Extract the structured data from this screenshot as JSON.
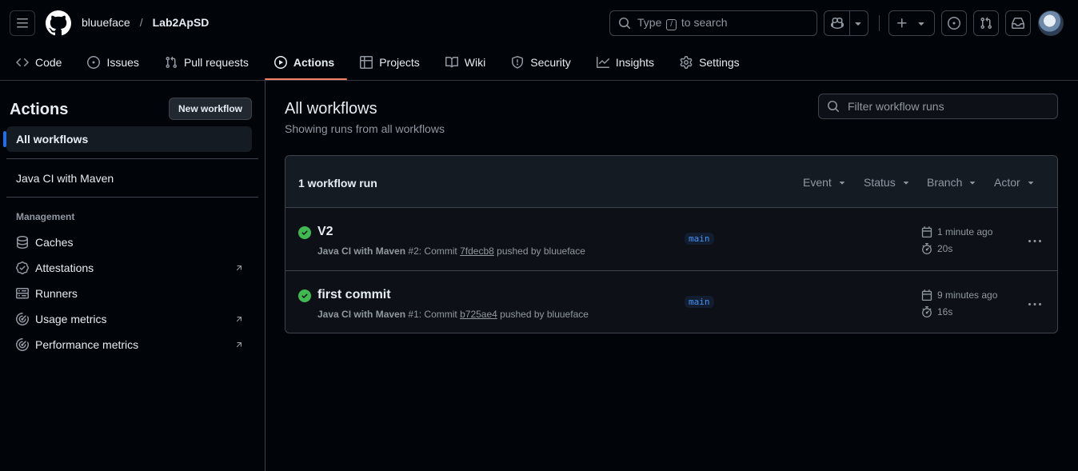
{
  "header": {
    "owner": "bluueface",
    "separator": "/",
    "repo": "Lab2ApSD",
    "search_prefix": "Type",
    "search_key": "/",
    "search_suffix": "to search"
  },
  "tabs": [
    {
      "label": "Code",
      "icon": "code-icon"
    },
    {
      "label": "Issues",
      "icon": "issue-icon"
    },
    {
      "label": "Pull requests",
      "icon": "pull-request-icon"
    },
    {
      "label": "Actions",
      "icon": "play-icon",
      "active": true
    },
    {
      "label": "Projects",
      "icon": "table-icon"
    },
    {
      "label": "Wiki",
      "icon": "book-icon"
    },
    {
      "label": "Security",
      "icon": "shield-icon"
    },
    {
      "label": "Insights",
      "icon": "graph-icon"
    },
    {
      "label": "Settings",
      "icon": "gear-icon"
    }
  ],
  "sidebar": {
    "title": "Actions",
    "new_workflow": "New workflow",
    "all_workflows": "All workflows",
    "workflow": "Java CI with Maven",
    "management_heading": "Management",
    "management": [
      {
        "label": "Caches",
        "icon": "database-icon"
      },
      {
        "label": "Attestations",
        "icon": "verified-icon",
        "external": true
      },
      {
        "label": "Runners",
        "icon": "server-icon"
      },
      {
        "label": "Usage metrics",
        "icon": "meter-icon",
        "external": true
      },
      {
        "label": "Performance metrics",
        "icon": "meter-icon",
        "external": true
      }
    ]
  },
  "main": {
    "title": "All workflows",
    "subtitle": "Showing runs from all workflows",
    "filter_placeholder": "Filter workflow runs",
    "run_count": "1 workflow run",
    "filters": [
      "Event",
      "Status",
      "Branch",
      "Actor"
    ],
    "runs": [
      {
        "title": "V2",
        "workflow": "Java CI with Maven",
        "number": "#2",
        "commit_prefix": ": Commit ",
        "commit": "7fdecb8",
        "pushed_by": "pushed by bluueface",
        "branch": "main",
        "time": "1 minute ago",
        "duration": "20s",
        "status": "success"
      },
      {
        "title": "first commit",
        "workflow": "Java CI with Maven",
        "number": "#1",
        "commit_prefix": ": Commit ",
        "commit": "b725ae4",
        "pushed_by": "pushed by bluueface",
        "branch": "main",
        "time": "9 minutes ago",
        "duration": "16s",
        "status": "success"
      }
    ]
  },
  "colors": {
    "accent_tab": "#f78166",
    "success": "#3fb950",
    "link": "#4493f8",
    "selected_bar": "#1f6feb"
  }
}
